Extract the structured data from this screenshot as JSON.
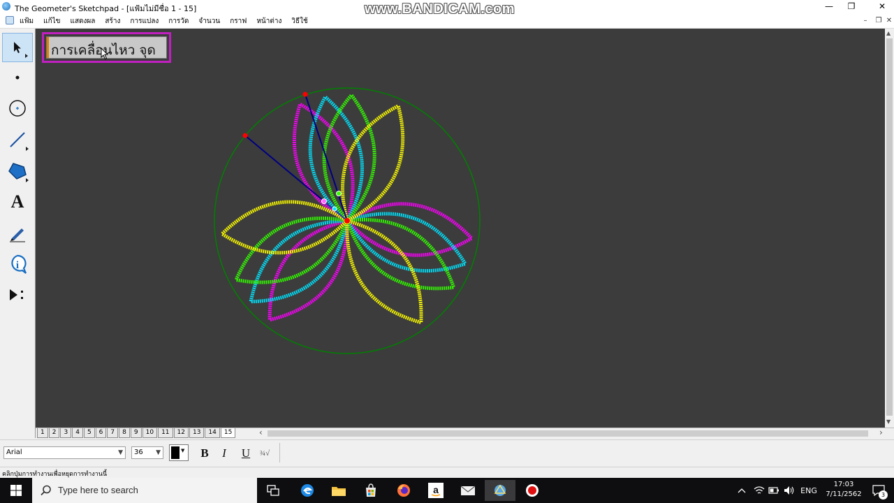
{
  "window": {
    "title": "The Geometer's Sketchpad - [แฟ้มไม่มีชื่อ 1 - 15]",
    "minimize_glyph": "—",
    "maximize_glyph": "❐",
    "close_glyph": "✕"
  },
  "watermark": "www.BANDICAM.com",
  "menu": {
    "items": [
      "แฟ้ม",
      "แก้ไข",
      "แสดงผล",
      "สร้าง",
      "การแปลง",
      "การวัด",
      "จำนวน",
      "กราฟ",
      "หน้าต่าง",
      "วิธีใช้"
    ],
    "mdi_minimize": "–",
    "mdi_restore": "❐",
    "mdi_close": "✕"
  },
  "toolbox": {
    "tools": [
      {
        "name": "arrow-tool",
        "icon": "arrow-icon",
        "selected": true
      },
      {
        "name": "point-tool",
        "icon": "point-icon"
      },
      {
        "name": "compass-tool",
        "icon": "circle-icon"
      },
      {
        "name": "straightedge-tool",
        "icon": "line-icon"
      },
      {
        "name": "polygon-tool",
        "icon": "polygon-icon"
      },
      {
        "name": "text-tool",
        "icon": "text-icon",
        "glyph": "A"
      },
      {
        "name": "marker-tool",
        "icon": "pencil-icon"
      },
      {
        "name": "information-tool",
        "icon": "info-icon",
        "glyph": "i"
      },
      {
        "name": "custom-tool",
        "icon": "play-icon"
      }
    ]
  },
  "canvas": {
    "caption_text": "การเคลื่อนไหว จุด",
    "background_color": "#3c3c3c",
    "circle_color": "#008000",
    "segment_color": "#000080",
    "point_color": "#ff0000",
    "trace_colors": [
      "#ff00ff",
      "#00e5ff",
      "#33ff00",
      "#ffff00"
    ]
  },
  "pages": {
    "tabs": [
      "1",
      "2",
      "3",
      "4",
      "5",
      "6",
      "7",
      "8",
      "9",
      "10",
      "11",
      "12",
      "13",
      "14",
      "15"
    ],
    "active_tab": "15",
    "scroll_left": "‹",
    "scroll_right": "›"
  },
  "text_toolbar": {
    "font": "Arial",
    "size": "36",
    "bold": "B",
    "italic": "I",
    "underline": "U",
    "symbol": "¾√",
    "color": "#000000"
  },
  "status_text": "คลิกปุ่มการทำงานเพื่อหยุดการทำงานนี้",
  "taskbar": {
    "search_placeholder": "Type here to search",
    "language": "ENG",
    "time": "17:03",
    "date": "7/11/2562",
    "notification_count": "3",
    "tray_up": "^"
  }
}
